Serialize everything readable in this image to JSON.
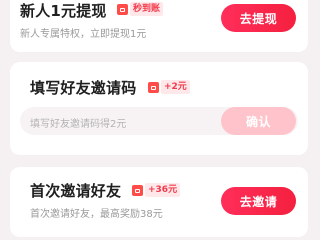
{
  "tasks": {
    "newbie_withdraw": {
      "title": "新人1元提现",
      "reward": "秒到账",
      "description": "新人专属特权，立即提现1元",
      "button": "去提现"
    },
    "invite_code": {
      "title": "填写好友邀请码",
      "reward": "+2元",
      "input_placeholder": "填写好友邀请码得2元",
      "button": "确认"
    },
    "first_invite": {
      "title": "首次邀请好友",
      "reward": "+36元",
      "description": "首次邀请好友，最高奖励38元",
      "button": "去邀请"
    }
  },
  "colors": {
    "background": "#f5f1f2",
    "accent": "#f5203f",
    "reward_text": "#f23a4b",
    "button_disabled": "#ffc4cb"
  },
  "icons": {
    "reward_tag": "red-envelope-icon"
  }
}
